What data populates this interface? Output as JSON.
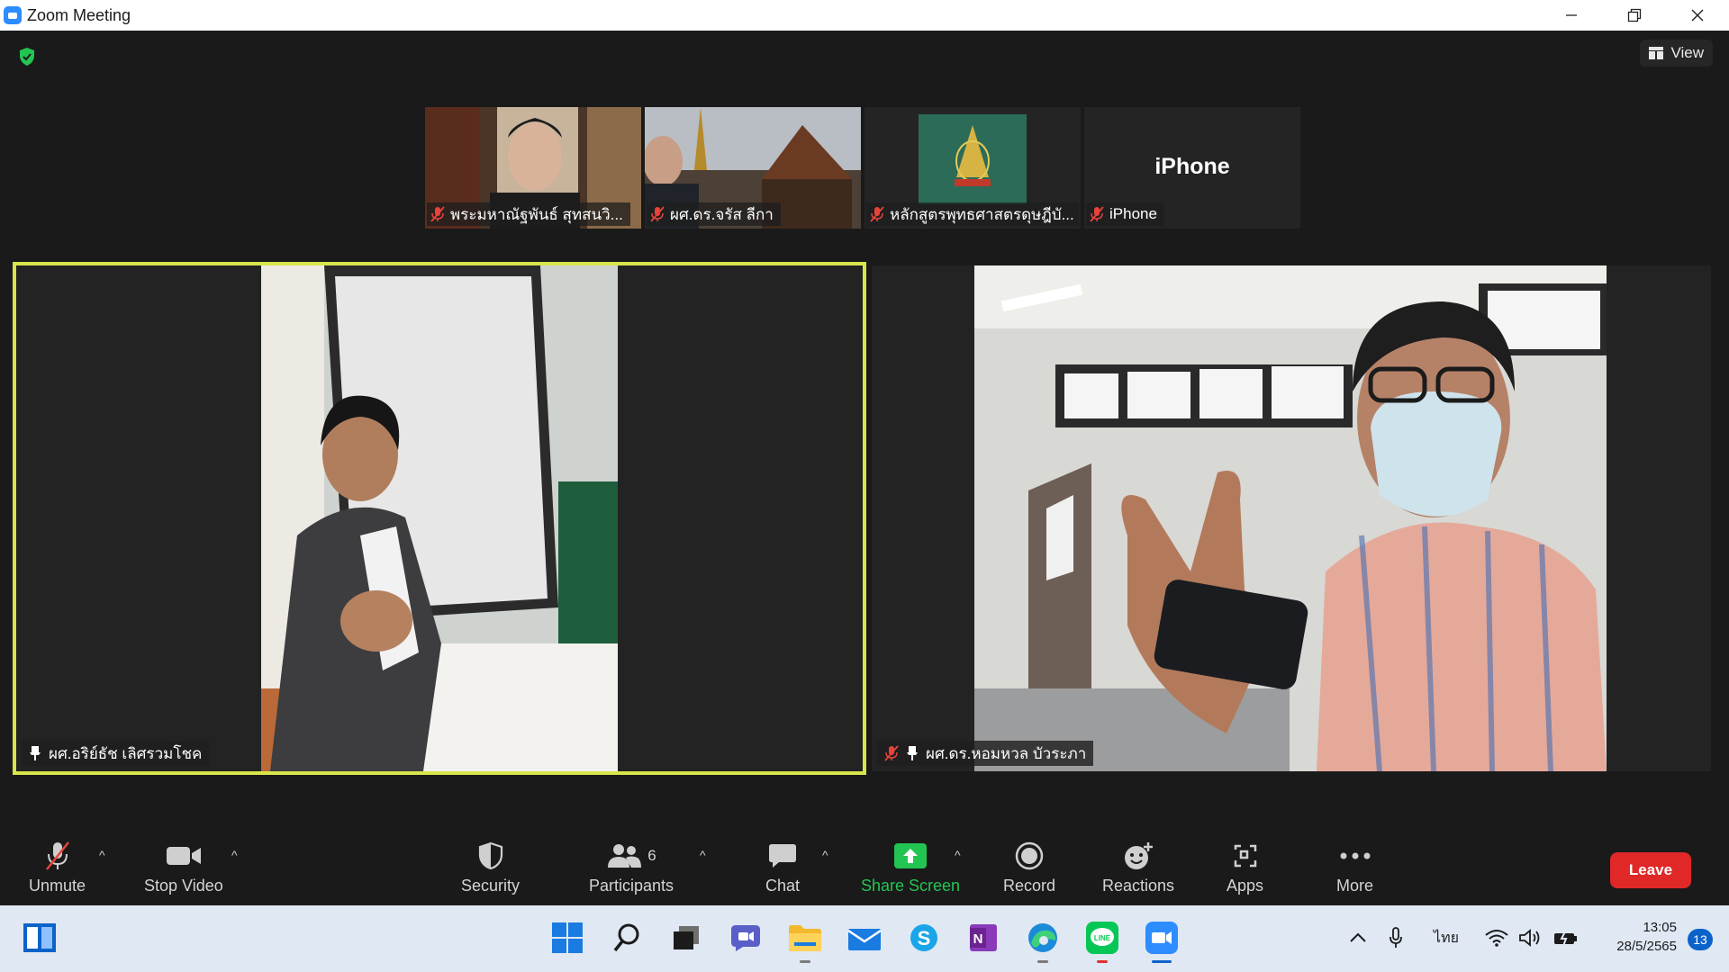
{
  "window": {
    "title": "Zoom Meeting"
  },
  "meeting": {
    "view_label": "View",
    "thumbnails": [
      {
        "name": "พระมหาณัฐพันธ์ สุทสนวิ..."
      },
      {
        "name": "ผศ.ดร.จรัส ลีกา"
      },
      {
        "name": "หลักสูตรพุทธศาสตรดุษฎีบั..."
      },
      {
        "name": "iPhone",
        "center_text": "iPhone"
      }
    ],
    "speaker_left": {
      "name": "ผศ.อริย์ธัช เลิศรวมโชค"
    },
    "speaker_right": {
      "name": "ผศ.ดร.หอมหวล บัวระภา"
    }
  },
  "toolbar": {
    "unmute": "Unmute",
    "stop_video": "Stop Video",
    "security": "Security",
    "participants": "Participants",
    "participants_count": "6",
    "chat": "Chat",
    "share_screen": "Share Screen",
    "record": "Record",
    "reactions": "Reactions",
    "apps": "Apps",
    "more": "More",
    "leave": "Leave"
  },
  "taskbar": {
    "language": "ไทย",
    "time": "13:05",
    "date": "28/5/2565",
    "notification_count": "13"
  },
  "colors": {
    "active_speaker_border": "#d7e64a",
    "share_screen_green": "#23c552",
    "leave_red": "#e02828",
    "mute_red": "#e8433a"
  }
}
